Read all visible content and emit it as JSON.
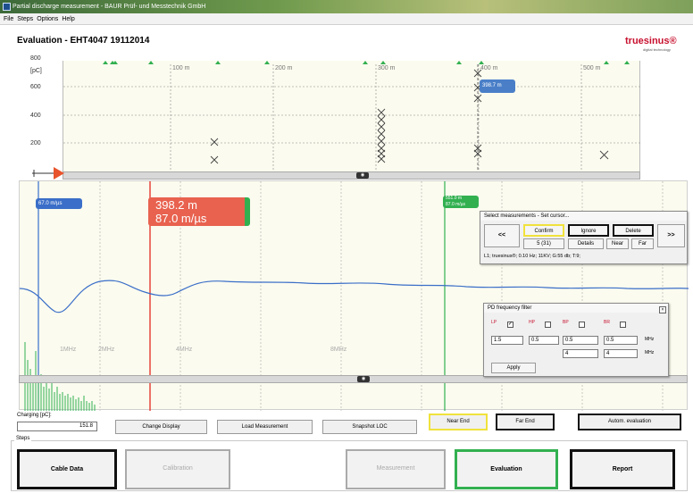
{
  "window": {
    "title": "Partial discharge measurement - BAUR Prüf- und Messtechnik GmbH"
  },
  "menu": [
    "File",
    "Steps",
    "Options",
    "Help"
  ],
  "page": {
    "title": "Evaluation - EHT4047 19112014"
  },
  "logo": {
    "text": "truesinus®",
    "sub": "digital technology"
  },
  "colors": {
    "accent": "#32b050",
    "red": "#e8453c",
    "blue": "#3a6ec8",
    "yellow": "#f0e23c",
    "curve": "#3a6ec8"
  },
  "top_plot": {
    "y_unit": "[pC]",
    "y_ticks": [
      "800",
      "600",
      "400",
      "200"
    ],
    "x_ticks": [
      "100 m",
      "200 m",
      "300 m",
      "400 m",
      "500 m"
    ],
    "cursor_label": "398.7 m"
  },
  "waveform": {
    "blue_cursor": "67.0 m/µs",
    "red_cursor_line1": "398.2 m",
    "red_cursor_line2": "87.0 m/µs",
    "green_cursor_line1": "551.0 m",
    "green_cursor_line2": "87.0 m/µs",
    "freq_ticks": [
      "1MHz",
      "2MHz",
      "4MHz",
      "8MHz"
    ]
  },
  "select_dialog": {
    "title": "Select measurements - Set cursor...",
    "prev": "<<",
    "next": ">>",
    "confirm": "Confirm",
    "ignore": "Ignore",
    "delete": "Delete",
    "counter": "5 (31)",
    "details": "Details",
    "near": "Near",
    "far": "Far",
    "info": "L1; truesinus®; 0.10 Hz; 11KV; G:55 db; T:9;"
  },
  "filter_dialog": {
    "title": "PD frequency filter",
    "labels": [
      "LP",
      "HP",
      "BP",
      "BR"
    ],
    "values_row1": [
      "1.5",
      "0.5",
      "0.5",
      "0.5"
    ],
    "values_row2": [
      "4",
      "4"
    ],
    "unit": "MHz",
    "apply": "Apply"
  },
  "charging": {
    "label": "Charging [pC]:",
    "value": "151.8"
  },
  "toolbar": {
    "change_display": "Change Display",
    "load_measurement": "Load Measurement",
    "snapshot": "Snapshot LOC",
    "near_end": "Near End",
    "far_end": "Far End",
    "autom": "Autom. evaluation"
  },
  "steps": {
    "title": "Steps",
    "cable_data": "Cable Data",
    "calibration": "Calibration",
    "measurement": "Measurement",
    "evaluation": "Evaluation",
    "report": "Report"
  }
}
